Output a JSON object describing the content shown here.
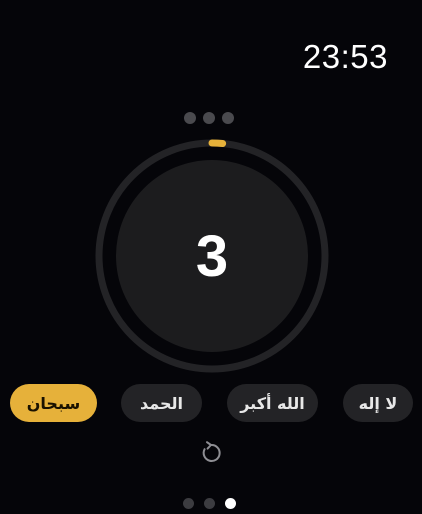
{
  "status": {
    "time": "23:53"
  },
  "counter": {
    "value": "3",
    "progress": 0.03,
    "accent_color": "#e6b13a",
    "track_color": "#232326",
    "face_color": "#1c1c1e"
  },
  "phrases": [
    {
      "label": "سبحان",
      "active": true
    },
    {
      "label": "الحمد",
      "active": false
    },
    {
      "label": "الله أكبر",
      "active": false
    },
    {
      "label": "لا إله",
      "active": false
    }
  ],
  "controls": {
    "reset_icon": "reset-icon",
    "menu_icon": "more-dots-icon"
  },
  "pagination": {
    "count": 3,
    "current": 3
  }
}
